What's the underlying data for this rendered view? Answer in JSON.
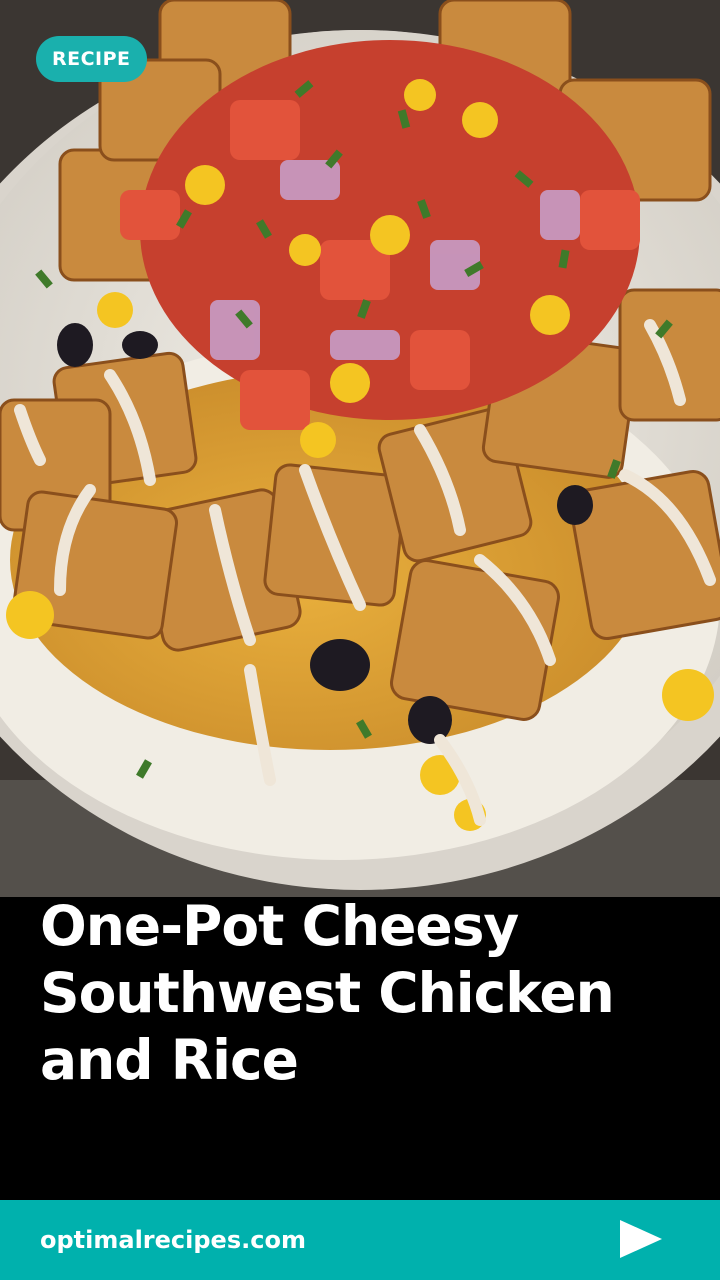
{
  "badge": {
    "label": "RECIPE"
  },
  "title": "One-Pot Cheesy Southwest Chicken and Rice",
  "footer": {
    "site": "optimalrecipes.com",
    "next_icon": "play-arrow-icon"
  },
  "colors": {
    "accent": "#00b1ad",
    "badge": "#1ab0ad",
    "text": "#ffffff",
    "background": "#000000"
  },
  "hero": {
    "alt": "photo of chicken, rice, cheese, black beans, corn and pico de gallo bowl"
  }
}
